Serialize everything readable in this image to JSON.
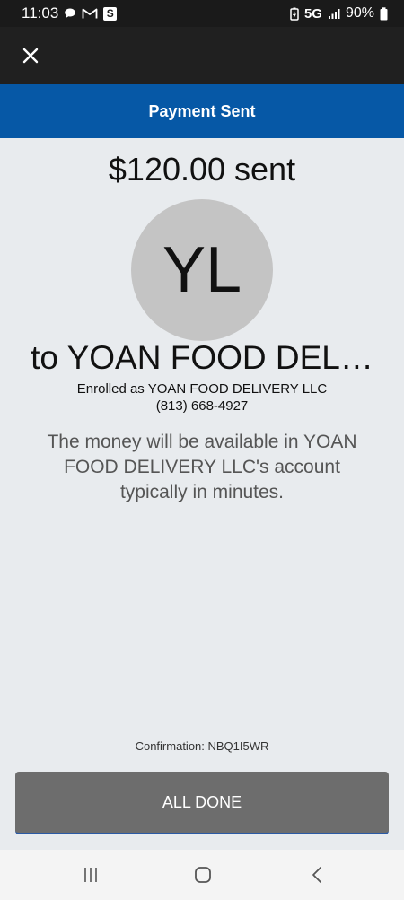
{
  "status_bar": {
    "time": "11:03",
    "network": "5G",
    "battery": "90%",
    "notification_badge": "S",
    "icons": [
      "chat-bubble-icon",
      "gmail-icon",
      "s-app-icon",
      "battery-saver-icon",
      "signal-icon",
      "battery-icon"
    ]
  },
  "header": {
    "close_icon": "close-icon",
    "title": "Payment Sent"
  },
  "payment": {
    "amount_text": "$120.00 sent",
    "avatar_initials": "YL",
    "recipient_text": "to YOAN FOOD DEL…",
    "enrolled_text": "Enrolled as YOAN FOOD DELIVERY LLC",
    "phone": "(813) 668-4927",
    "message": "The money will be available in YOAN FOOD DELIVERY LLC's account typically in minutes."
  },
  "footer": {
    "confirmation": "Confirmation: NBQ1I5WR",
    "done_label": "ALL DONE"
  },
  "nav_bar": {
    "icons": [
      "recent-apps-icon",
      "home-icon",
      "back-icon"
    ]
  },
  "colors": {
    "app_bar": "#202020",
    "title_bar": "#0658a6",
    "background": "#e8ebee",
    "avatar": "#c4c4c4",
    "button": "#6d6d6d"
  }
}
